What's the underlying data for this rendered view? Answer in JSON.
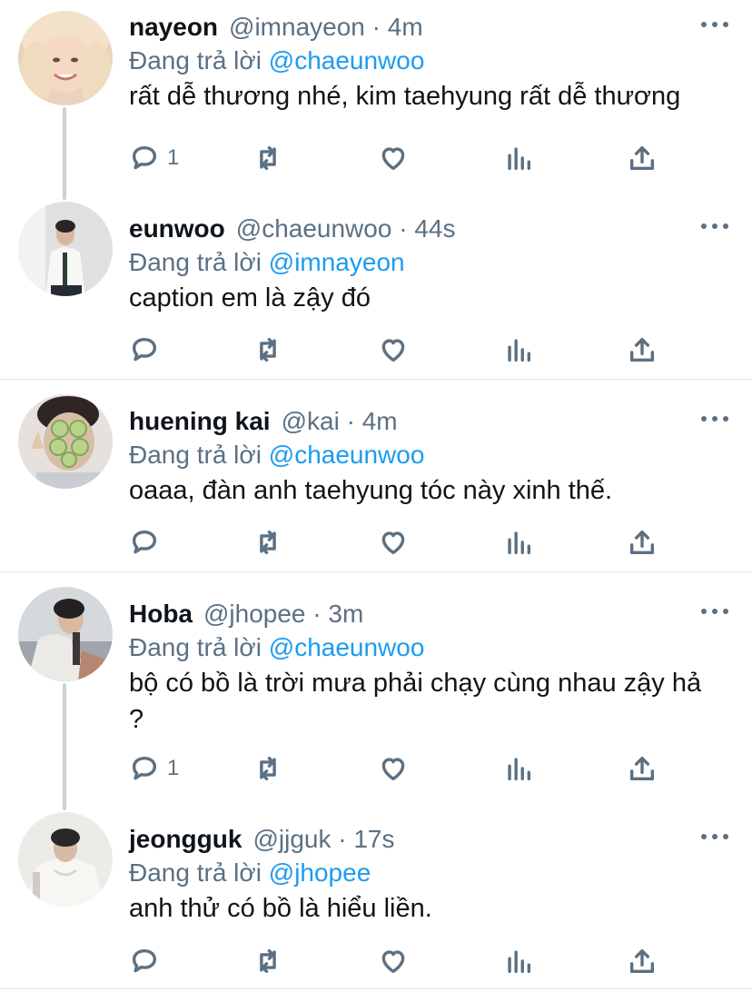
{
  "reply_prefix": "Đang trả lời",
  "tweets": [
    {
      "name": "nayeon",
      "handle": "@imnayeon",
      "time": "4m",
      "reply_to": "@chaeunwoo",
      "text": "rất dễ thương nhé, kim taehyung rất dễ thương",
      "reply_count": "1"
    },
    {
      "name": "eunwoo",
      "handle": "@chaeunwoo",
      "time": "44s",
      "reply_to": "@imnayeon",
      "text": "caption em là zậy đó",
      "reply_count": ""
    },
    {
      "name": "huening kai",
      "handle": "@kai",
      "time": "4m",
      "reply_to": "@chaeunwoo",
      "text": "oaaa, đàn anh taehyung tóc này xinh thế.",
      "reply_count": ""
    },
    {
      "name": "Hoba",
      "handle": "@jhopee",
      "time": "3m",
      "reply_to": "@chaeunwoo",
      "text": "bộ có bồ là trời mưa phải chạy cùng nhau zậy hả ?",
      "reply_count": "1"
    },
    {
      "name": "jeongguk",
      "handle": "@jjguk",
      "time": "17s",
      "reply_to": "@jhopee",
      "text": "anh thử có bồ là hiểu liền.",
      "reply_count": ""
    }
  ],
  "icons": {
    "reply": "speech-bubble-icon",
    "retweet": "retweet-arrows-icon",
    "like": "heart-outline-icon",
    "analytics": "bar-chart-icon",
    "share": "share-upload-icon",
    "more": "three-dots-icon"
  },
  "colors": {
    "name": "#0f1419",
    "meta": "#5b7083",
    "mention": "#1d9bf0",
    "divider": "#e3e6e9",
    "thread_line": "#c9d1d8"
  }
}
